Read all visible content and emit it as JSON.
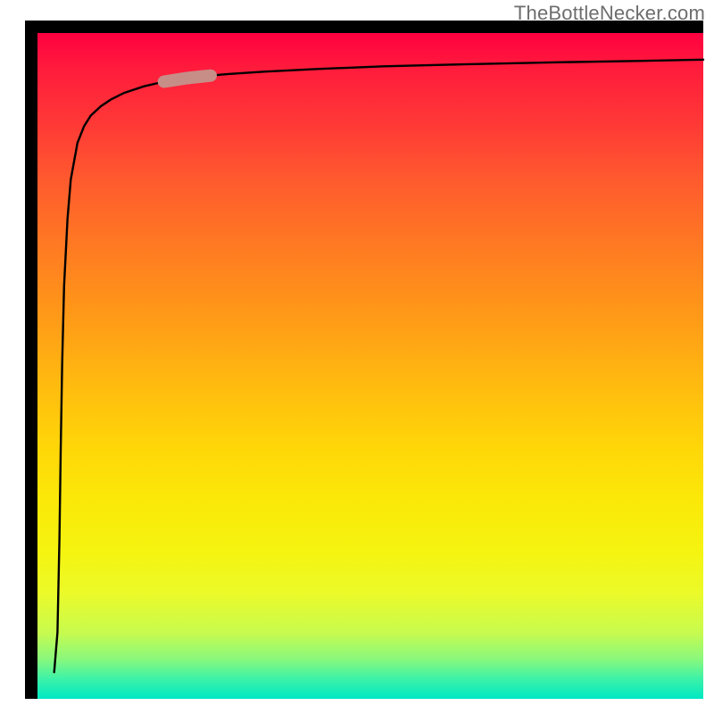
{
  "watermark": "TheBottleNecker.com",
  "chart_data": {
    "type": "line",
    "title": "",
    "xlabel": "",
    "ylabel": "",
    "xlim": [
      0,
      100
    ],
    "ylim": [
      0,
      100
    ],
    "series": [
      {
        "name": "curve",
        "x": [
          2.5,
          3.0,
          3.3,
          3.5,
          3.7,
          4.0,
          4.5,
          5.0,
          6.0,
          7.0,
          8.0,
          9.5,
          11.0,
          13.0,
          16.0,
          19.0,
          23.0,
          28.0,
          34.0,
          42.0,
          52.0,
          64.0,
          78.0,
          90.0,
          100.0
        ],
        "y": [
          4.0,
          10.0,
          24.0,
          38.0,
          50.0,
          62.0,
          72.0,
          78.0,
          83.5,
          86.0,
          87.6,
          89.0,
          90.0,
          91.0,
          92.0,
          92.7,
          93.3,
          93.8,
          94.2,
          94.6,
          95.0,
          95.3,
          95.6,
          95.8,
          96.0
        ]
      }
    ],
    "marker": {
      "x_range": [
        19,
        26
      ],
      "y_range": [
        85,
        89
      ],
      "color": "#c78d87"
    },
    "gradient_stops": [
      {
        "pos": 0,
        "color": "#ff0040"
      },
      {
        "pos": 14,
        "color": "#ff3a36"
      },
      {
        "pos": 32,
        "color": "#ff7a22"
      },
      {
        "pos": 52,
        "color": "#ffb810"
      },
      {
        "pos": 70,
        "color": "#fbe808"
      },
      {
        "pos": 84,
        "color": "#ecfa28"
      },
      {
        "pos": 94,
        "color": "#8af87c"
      },
      {
        "pos": 100,
        "color": "#00e8c4"
      }
    ]
  }
}
